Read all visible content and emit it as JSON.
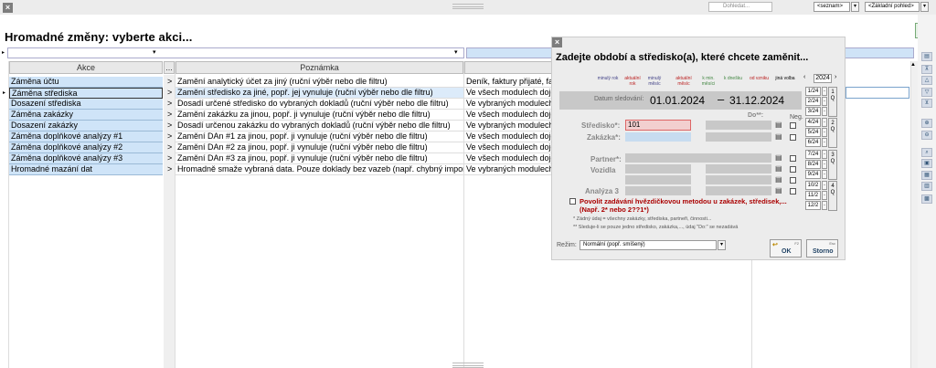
{
  "topbar": {
    "search_placeholder": "Dohledat...",
    "view_select": "<seznam>",
    "layout_select": "<Základní pohled>"
  },
  "page": {
    "title": "Hromadné změny: vyberte akci..."
  },
  "table": {
    "headers": [
      "Akce",
      "...",
      "Poznámka"
    ],
    "rows": [
      {
        "action": "Záměna účtu",
        "mark": ">",
        "note": "Zamění analytický účet za jiný (ruční výběr nebo dle filtru)",
        "scope": "Deník, faktury přijaté, fakt"
      },
      {
        "action": "Záměna střediska",
        "mark": ">",
        "note": "Zamění středisko za jiné, popř. jej vynuluje (ruční výběr nebo dle filtru)",
        "scope": "Ve všech modulech dojd"
      },
      {
        "action": "Dosazení střediska",
        "mark": ">",
        "note": "Dosadí určené středisko do vybraných dokladů (ruční výběr nebo dle filtru)",
        "scope": "Ve vybraných modulech"
      },
      {
        "action": "Záměna zakázky",
        "mark": ">",
        "note": "Zamění zakázku za jinou, popř. ji vynuluje (ruční výběr nebo dle filtru)",
        "scope": "Ve všech modulech dojd"
      },
      {
        "action": "Dosazení zakázky",
        "mark": ">",
        "note": "Dosadí určenou zakázku do vybraných dokladů (ruční výběr nebo dle filtru)",
        "scope": "Ve vybraných modulech"
      },
      {
        "action": "Záměna doplňkové analýzy #1",
        "mark": ">",
        "note": "Zamění DAn #1 za jinou, popř. ji vynuluje (ruční výběr nebo dle filtru)",
        "scope": "Ve všech modulech dojd"
      },
      {
        "action": "Záměna doplňkové analýzy #2",
        "mark": ">",
        "note": "Zamění DAn #2 za jinou, popř. ji vynuluje (ruční výběr nebo dle filtru)",
        "scope": "Ve všech modulech dojd"
      },
      {
        "action": "Záměna doplňkové analýzy #3",
        "mark": ">",
        "note": "Zamění DAn #3 za jinou, popř. ji vynuluje (ruční výběr nebo dle filtru)",
        "scope": "Ve všech modulech dojd"
      },
      {
        "action": "Hromadné mazání dat",
        "mark": ">",
        "note": "Hromadně smaže vybraná data. Pouze doklady bez vazeb (např. chybný import...)",
        "scope": "Ve vybraných modulech"
      }
    ]
  },
  "dialog": {
    "title": "Zadejte období a středisko(a), které chcete zaměnit...",
    "tabs": [
      "minulý rok",
      "aktuální rok",
      "minulý měsíc",
      "aktuální měsíc",
      "k min. měsíci",
      "k dnešku",
      "od vzniku",
      "jiná volba"
    ],
    "year": "2024",
    "date_label": "Datum sledování:",
    "date_from": "01.01.2024",
    "date_dash": "–",
    "date_to": "31.12.2024",
    "do_label": "Do**:",
    "neg_label": "Neg.",
    "stredisko_label": "Středisko*:",
    "stredisko_value": "101",
    "zakazka_label": "Zakázka*:",
    "partner_label": "Partner*:",
    "vozidla_label": "Vozidla",
    "analyza_label": "Analýza 3",
    "months": [
      "1/24",
      "2/24",
      "3/24",
      "4/24",
      "5/24",
      "6/24",
      "7/24",
      "8/24",
      "9/24",
      "10/2",
      "11/2",
      "12/2"
    ],
    "quarters": [
      "1 Q",
      "2 Q",
      "3 Q",
      "4 Q"
    ],
    "minus": "-",
    "wildcard_text": "Povolit zadávání hvězdičkovou metodou u zakázek, středisek,... (Např. 2* nebo 2??1*)",
    "note1": "* Žádný údaj = všechny zakázky, střediska, partneři, činnosti...",
    "note2": "** Sleduje-li se pouze jedno středisko, zakázka,..., údaj \"Do:\" se nezadává",
    "mode_label": "Režim:",
    "mode_value": "Normální (popř. smíšený)",
    "ok_label": "OK",
    "ok_key": "F2",
    "cancel_label": "Storno",
    "cancel_key": "Esc"
  }
}
